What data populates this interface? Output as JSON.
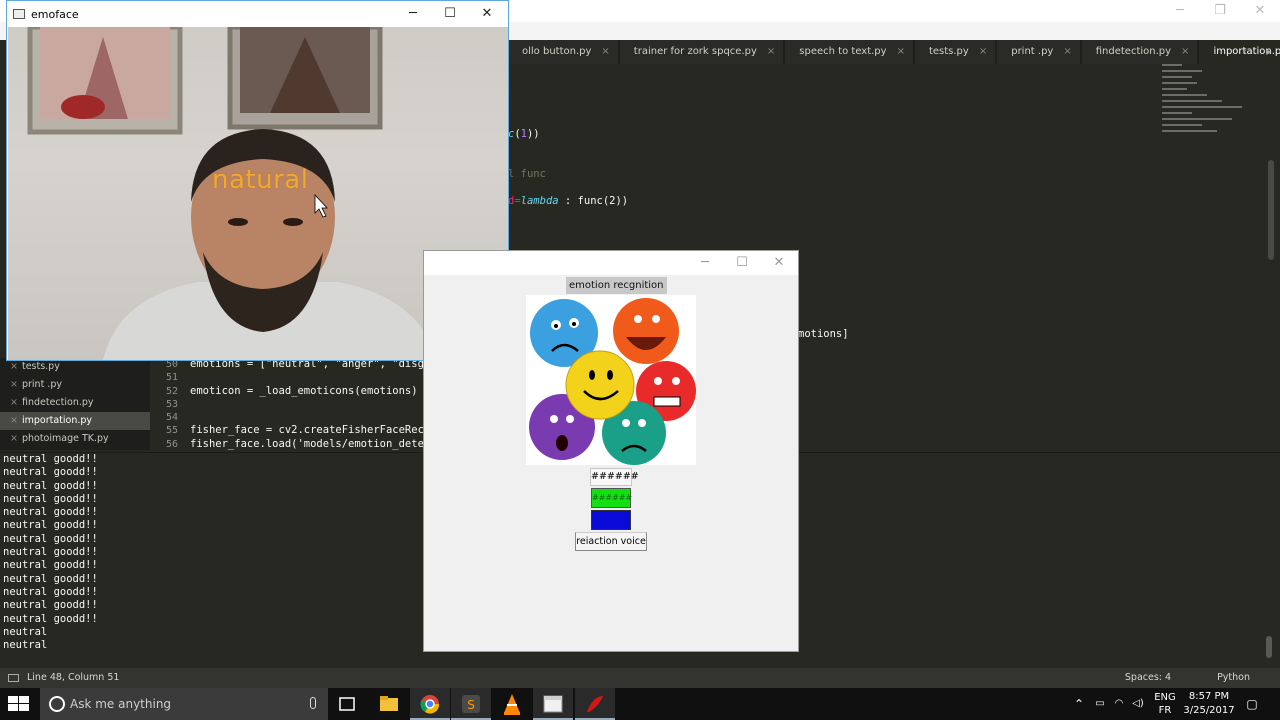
{
  "editor": {
    "tabs": [
      {
        "label": "ollo button.py",
        "active": false
      },
      {
        "label": "trainer for zork spqce.py",
        "active": false
      },
      {
        "label": "speech to text.py",
        "active": false
      },
      {
        "label": "tests.py",
        "active": false
      },
      {
        "label": "print .py",
        "active": false
      },
      {
        "label": "findetection.py",
        "active": false
      },
      {
        "label": "importation.py",
        "active": true
      },
      {
        "label": "y",
        "active": false
      }
    ],
    "tab_close": "×",
    "code_top": {
      "line1": "(1))",
      "line2": "l func",
      "line3_kw": "d=",
      "line3_lambda": "lambda",
      "line3_rest": " : func(2))",
      "line4": "motions]"
    },
    "sidebar": [
      {
        "label": "tests.py",
        "active": false
      },
      {
        "label": "print .py",
        "active": false
      },
      {
        "label": "findetection.py",
        "active": false
      },
      {
        "label": "importation.py",
        "active": true
      },
      {
        "label": "photoimage TK.py",
        "active": false
      }
    ],
    "sidebar_close": "×",
    "gutter": [
      "50",
      "51",
      "52",
      "53",
      "54",
      "55",
      "56"
    ],
    "code_lines": [
      "emotions = [\"neutral\", \"anger\", \"disgus",
      "",
      "emoticon = _load_emoticons(emotions)",
      "",
      "",
      "fisher_face = cv2.createFisherFaceRecog",
      "fisher_face.load('models/emotion_detect"
    ]
  },
  "console": {
    "lines": [
      "neutral goodd!!",
      "neutral goodd!!",
      "neutral goodd!!",
      "neutral goodd!!",
      "neutral goodd!!",
      "neutral goodd!!",
      "neutral goodd!!",
      "neutral goodd!!",
      "neutral goodd!!",
      "neutral goodd!!",
      "neutral goodd!!",
      "neutral goodd!!",
      "neutral goodd!!",
      "neutral",
      "neutral"
    ]
  },
  "statusbar": {
    "position": "Line 48, Column 51",
    "spaces": "Spaces: 4",
    "syntax": "Python"
  },
  "emoface": {
    "title": "emoface",
    "minimize": "─",
    "maximize": "☐",
    "close": "✕",
    "detected_emotion": "natural"
  },
  "tkwin": {
    "minimize": "─",
    "maximize": "☐",
    "close": "✕",
    "title_label": "emotion recgnition",
    "hash_button": "######",
    "green_button": "######",
    "voice_button": "reiaction voice"
  },
  "taskbar": {
    "search_placeholder": "Ask me anything",
    "language_top": "ENG",
    "language_bottom": "FR",
    "time": "8:57 PM",
    "date": "3/25/2017"
  },
  "colors": {
    "editor_bg": "#272822",
    "accent_window_border": "#5fa8dc",
    "label_orange": "#f0a830",
    "green_button": "#12e012",
    "blue_button": "#0a0ad8"
  }
}
